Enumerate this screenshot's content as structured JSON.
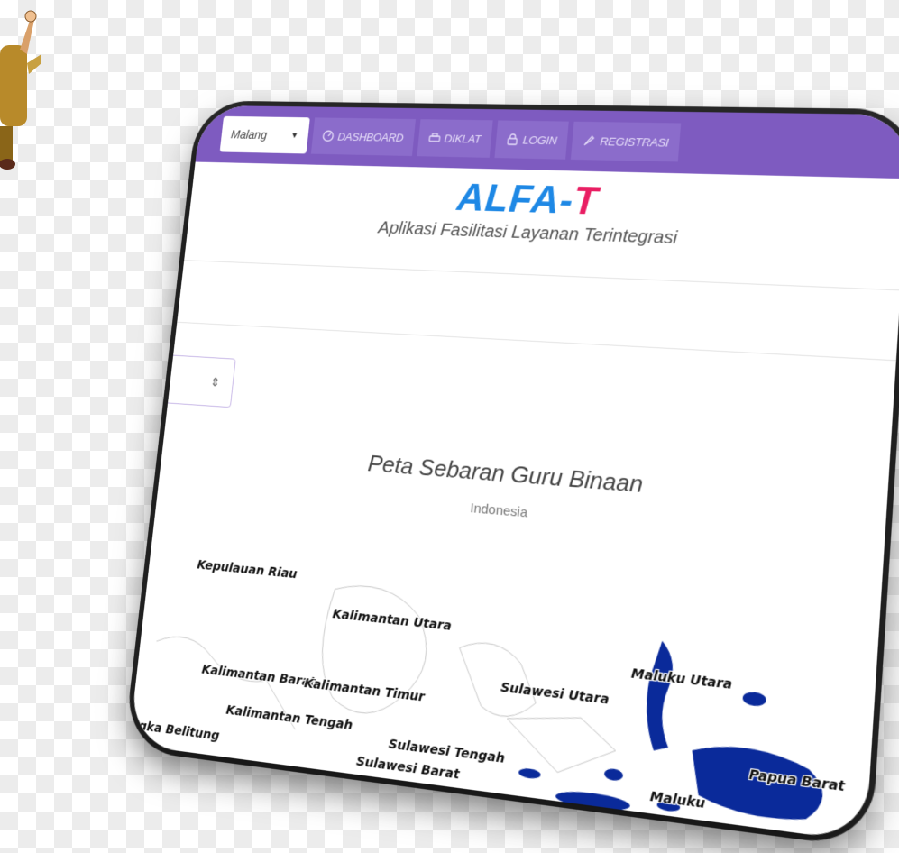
{
  "navbar": {
    "region_select": "Malang",
    "items": [
      {
        "label": "DASHBOARD",
        "icon": "dashboard-icon"
      },
      {
        "label": "DIKLAT",
        "icon": "printer-icon"
      },
      {
        "label": "LOGIN",
        "icon": "lock-icon"
      },
      {
        "label": "REGISTRASI",
        "icon": "rocket-icon"
      }
    ]
  },
  "brand": {
    "title_part1": "ALFA",
    "title_dash": "-",
    "title_part2": "T",
    "subtitle": "Aplikasi Fasilitasi Layanan Terintegrasi"
  },
  "map": {
    "title": "Peta Sebaran Guru Binaan",
    "subtitle": "Indonesia",
    "labels": [
      "Kepulauan Riau",
      "Kalimantan Utara",
      "Maluku Utara",
      "Sulawesi Utara",
      "Kalimantan Barat",
      "Kalimantan Timur",
      "Kalimantan Tengah",
      "Sulawesi Tengah",
      "Papua Barat",
      "Sulawesi Barat",
      "Bangka Belitung",
      "Maluku"
    ]
  },
  "colors": {
    "navbar": "#7e5bc0",
    "brand_blue": "#1e88e5",
    "brand_pink": "#e91e63",
    "map_fill": "#0a2a9a"
  }
}
